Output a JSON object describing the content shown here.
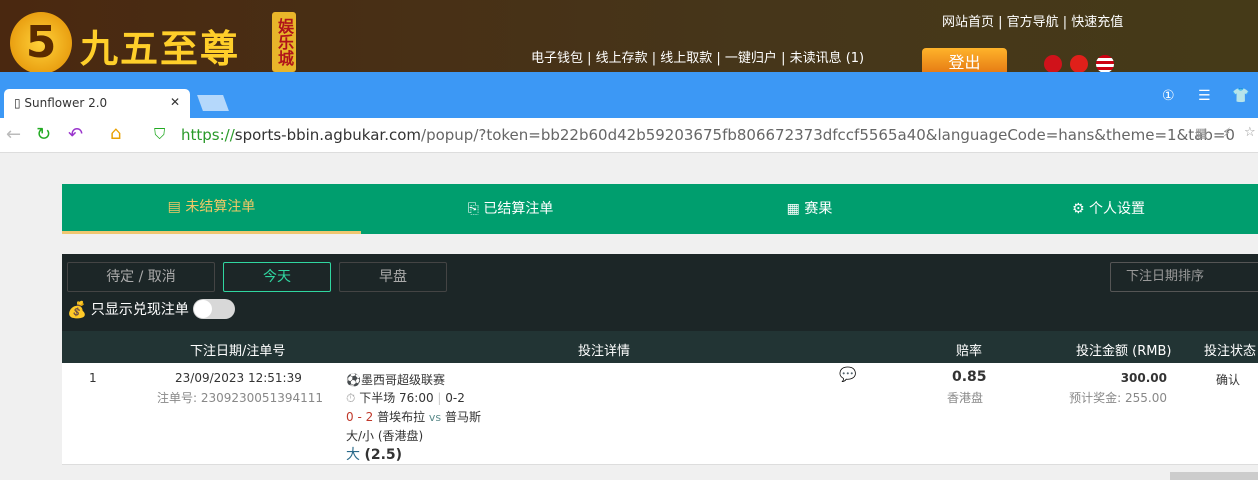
{
  "banner": {
    "logo_mark": "5",
    "logo_text": "九五至尊",
    "logo_sub": "娱乐城",
    "top_links": "网站首页 | 官方导航 | 快速充值",
    "mid_links": "电子钱包 | 线上存款 | 线上取款 | 一键归户 | 未读讯息 (1)",
    "logout": "登出"
  },
  "browser": {
    "tab_title": "Sunflower 2.0",
    "tab_close": "✕",
    "url_scheme": "https://",
    "url_domain": "sports-bbin.agbukar.com",
    "url_path": "/popup/?token=bb22b60d42b59203675fb806672373dfccf5565a40&languageCode=hans&theme=1&tab=0"
  },
  "nav_tabs": [
    {
      "label": "未结算注单",
      "icon": "▤"
    },
    {
      "label": "已结算注单",
      "icon": "⎘"
    },
    {
      "label": "赛果",
      "icon": "▦"
    },
    {
      "label": "个人设置",
      "icon": "⚙"
    }
  ],
  "filters": {
    "pending": "待定 / 取消",
    "today": "今天",
    "early": "早盘",
    "sort_placeholder": "下注日期排序",
    "cashout_only": "只显示兑现注单"
  },
  "table": {
    "headers": {
      "date": "下注日期/注单号",
      "detail": "投注详情",
      "odds": "赔率",
      "amount": "投注金额 (RMB)",
      "status": "投注状态"
    },
    "rows": [
      {
        "index": "1",
        "datetime": "23/09/2023 12:51:39",
        "ticket": "注单号: 2309230051394111",
        "league": "墨西哥超级联赛",
        "period": "下半场 76:00",
        "period_score": "0-2",
        "score": "0 - 2",
        "home": "普埃布拉",
        "vs": "vs",
        "away": "普马斯",
        "market": "大/小 (香港盘)",
        "pick": "大",
        "line": "(2.5)",
        "odds": "0.85",
        "odds_type": "香港盘",
        "amount": "300.00",
        "payout": "预计奖金: 255.00",
        "status": "确认"
      }
    ]
  }
}
